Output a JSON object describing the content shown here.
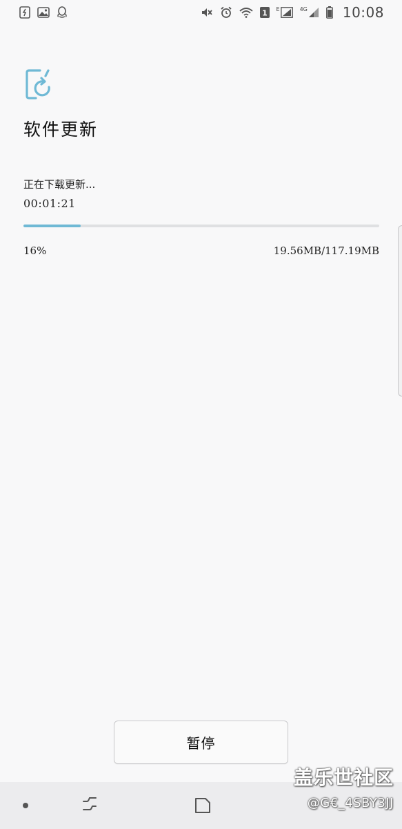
{
  "status_bar": {
    "left_icons": [
      "voice-memo-icon",
      "gallery-icon",
      "qq-icon"
    ],
    "right_icons": [
      "mute-icon",
      "alarm-icon",
      "wifi-icon",
      "sim-1-icon",
      "signal-icon",
      "signal-4g-icon",
      "battery-icon"
    ],
    "sim_label": "1",
    "network_e_label": "E",
    "network_4g_label": "4G",
    "time": "10:08"
  },
  "header": {
    "icon": "software-update-icon",
    "title": "软件更新"
  },
  "download": {
    "status_text": "正在下载更新...",
    "elapsed": "00:01:21",
    "progress_percent": 16,
    "percent_label": "16%",
    "size_label": "19.56MB/117.19MB"
  },
  "actions": {
    "pause_label": "暂停"
  },
  "nav_bar": {
    "icons": [
      "nav-dot-icon",
      "recents-icon",
      "home-icon"
    ]
  },
  "watermark": {
    "title": "盖乐世社区",
    "handle": "@G€_4SBY3JJ"
  },
  "colors": {
    "background": "#f8f8f9",
    "accent": "#6fb9d5",
    "track": "#dfe0e2",
    "nav_bar": "#ececee"
  }
}
